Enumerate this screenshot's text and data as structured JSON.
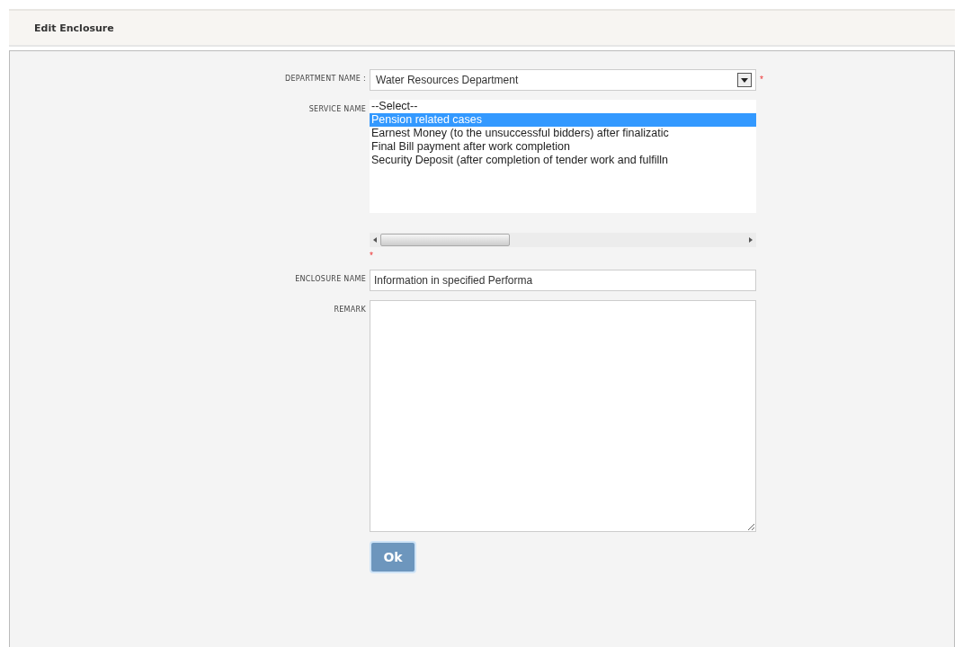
{
  "header": {
    "title": "Edit Enclosure"
  },
  "form": {
    "department": {
      "label": "DEPARTMENT NAME :",
      "value": "Water Resources Department",
      "required_mark": "*"
    },
    "service": {
      "label": "SERVICE NAME",
      "options": [
        {
          "label": "--Select--",
          "selected": false
        },
        {
          "label": "Pension related cases",
          "selected": true
        },
        {
          "label": "Earnest Money (to the unsuccessful bidders) after finalizatic",
          "selected": false
        },
        {
          "label": "Final Bill payment after work completion",
          "selected": false
        },
        {
          "label": "Security Deposit (after completion of tender work and fulfilln",
          "selected": false
        }
      ],
      "required_mark": "*"
    },
    "enclosure": {
      "label": "ENCLOSURE NAME",
      "value": "Information in specified Performa"
    },
    "remark": {
      "label": "REMARK"
    },
    "submit": {
      "label": "Ok"
    }
  }
}
